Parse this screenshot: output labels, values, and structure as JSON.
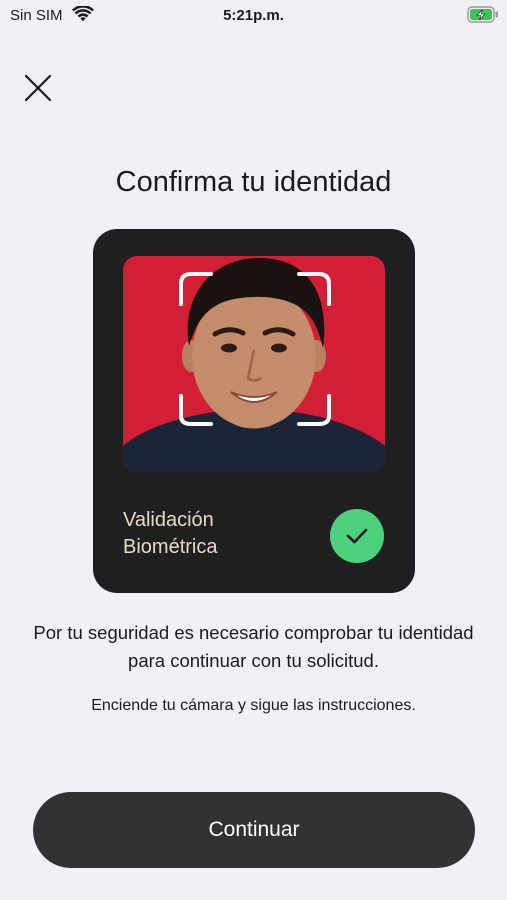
{
  "status_bar": {
    "carrier": "Sin SIM",
    "time": "5:21p.m.",
    "battery_color": "#3cc453",
    "icons": [
      "wifi-icon",
      "battery-charging-icon"
    ]
  },
  "header": {
    "close_icon": "close-icon",
    "title": "Confirma tu identidad"
  },
  "card": {
    "photo_background": "#d21f35",
    "label": "Validación Biométrica",
    "status_icon": "checkmark-icon",
    "status_color": "#4bd07e"
  },
  "body": {
    "description": "Por tu seguridad es necesario comprobar tu identidad para continuar con tu solicitud.",
    "hint": "Enciende tu cámara y sigue las instrucciones."
  },
  "actions": {
    "continue_label": "Continuar"
  }
}
